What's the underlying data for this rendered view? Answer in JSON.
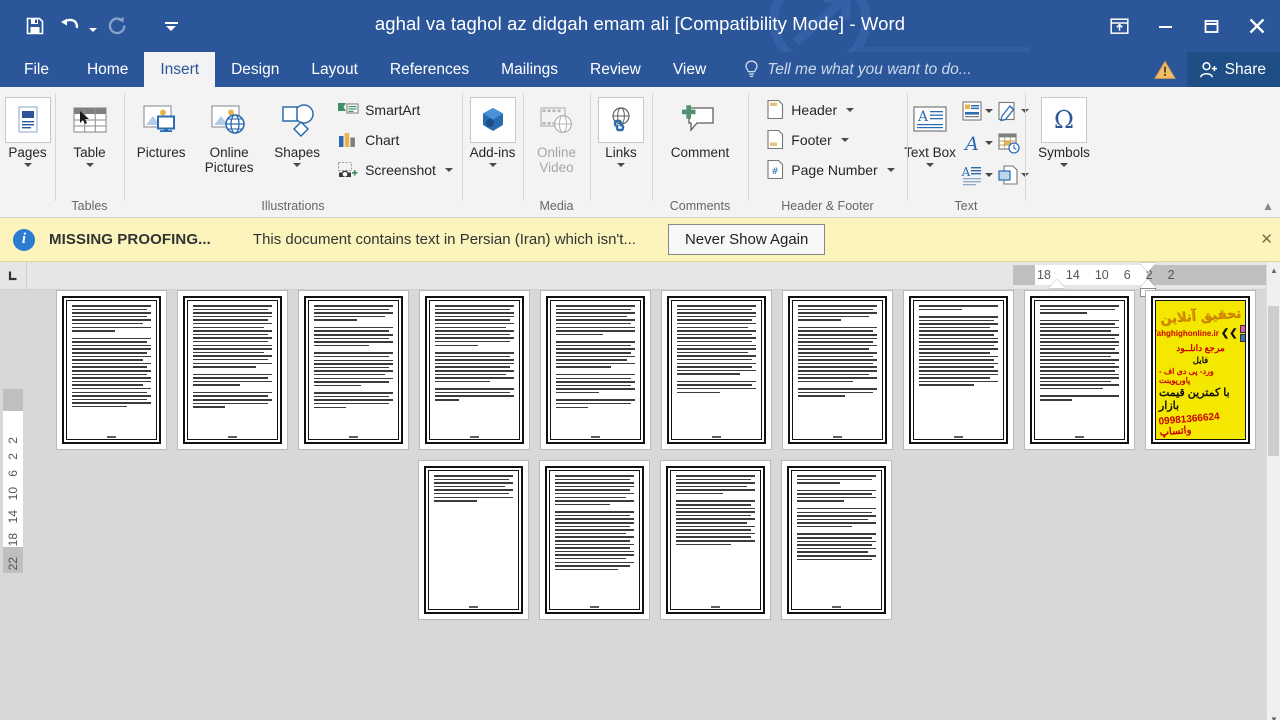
{
  "titlebar": {
    "document_title": "aghal va taghol az didgah emam ali [Compatibility Mode] - Word",
    "quick_access": [
      {
        "name": "save",
        "icon": "save-icon",
        "label": "Save",
        "disabled": false
      },
      {
        "name": "undo",
        "icon": "undo-icon",
        "label": "Undo",
        "disabled": false
      },
      {
        "name": "redo",
        "icon": "redo-icon",
        "label": "Repeat",
        "disabled": true
      },
      {
        "name": "customize",
        "icon": "customize-quick-access-icon",
        "label": "Customize Quick Access Toolbar",
        "disabled": false
      }
    ],
    "window_controls": [
      {
        "name": "ribbon-display-options",
        "icon": "ribbon-display-options-icon",
        "glyph": "⤒"
      },
      {
        "name": "minimize",
        "icon": "minimize-icon",
        "glyph": "–"
      },
      {
        "name": "restore",
        "icon": "restore-icon",
        "glyph": "□"
      },
      {
        "name": "close",
        "icon": "close-icon",
        "glyph": "✕"
      }
    ]
  },
  "tabs": {
    "items": [
      {
        "label": "File",
        "active": false
      },
      {
        "label": "Home",
        "active": false
      },
      {
        "label": "Insert",
        "active": true
      },
      {
        "label": "Design",
        "active": false
      },
      {
        "label": "Layout",
        "active": false
      },
      {
        "label": "References",
        "active": false
      },
      {
        "label": "Mailings",
        "active": false
      },
      {
        "label": "Review",
        "active": false
      },
      {
        "label": "View",
        "active": false
      }
    ],
    "tell_me": "Tell me what you want to do...",
    "share_label": "Share",
    "warning_icon": "warning-triangle-icon"
  },
  "ribbon": {
    "groups": [
      {
        "label": "",
        "name": "pages-group",
        "buttons": [
          {
            "label": "Pages",
            "icon": "pages-icon",
            "has_dropdown": true,
            "disabled": false
          }
        ]
      },
      {
        "label": "Tables",
        "name": "tables-group",
        "buttons": [
          {
            "label": "Table",
            "icon": "table-icon",
            "has_dropdown": true,
            "disabled": false
          }
        ]
      },
      {
        "label": "Illustrations",
        "name": "illustrations-group",
        "buttons": [
          {
            "label": "Pictures",
            "icon": "pictures-icon",
            "has_dropdown": false,
            "disabled": false
          },
          {
            "label": "Online Pictures",
            "icon": "online-pictures-icon",
            "has_dropdown": false,
            "disabled": false
          },
          {
            "label": "Shapes",
            "icon": "shapes-icon",
            "has_dropdown": true,
            "disabled": false
          }
        ],
        "small_buttons": [
          {
            "label": "SmartArt",
            "icon": "smartart-icon",
            "has_dropdown": false
          },
          {
            "label": "Chart",
            "icon": "chart-icon",
            "has_dropdown": false
          },
          {
            "label": "Screenshot",
            "icon": "screenshot-icon",
            "has_dropdown": true
          }
        ]
      },
      {
        "label": "",
        "name": "addins-group",
        "buttons": [
          {
            "label": "Add-ins",
            "icon": "addins-icon",
            "has_dropdown": true,
            "disabled": false
          }
        ]
      },
      {
        "label": "Media",
        "name": "media-group",
        "buttons": [
          {
            "label": "Online Video",
            "icon": "online-video-icon",
            "has_dropdown": false,
            "disabled": true
          }
        ]
      },
      {
        "label": "",
        "name": "links-group",
        "buttons": [
          {
            "label": "Links",
            "icon": "links-icon",
            "has_dropdown": true,
            "disabled": false
          }
        ]
      },
      {
        "label": "Comments",
        "name": "comments-group",
        "buttons": [
          {
            "label": "Comment",
            "icon": "comment-icon",
            "has_dropdown": false,
            "disabled": false
          }
        ]
      },
      {
        "label": "Header & Footer",
        "name": "header-footer-group",
        "small_buttons": [
          {
            "label": "Header",
            "icon": "header-icon",
            "has_dropdown": true
          },
          {
            "label": "Footer",
            "icon": "footer-icon",
            "has_dropdown": true
          },
          {
            "label": "Page Number",
            "icon": "page-number-icon",
            "has_dropdown": true
          }
        ]
      },
      {
        "label": "Text",
        "name": "text-group",
        "buttons": [
          {
            "label": "Text Box",
            "icon": "text-box-icon",
            "has_dropdown": true,
            "disabled": false
          }
        ],
        "icon_grid": [
          {
            "name": "quick-parts-icon",
            "has_dropdown": true
          },
          {
            "name": "signature-line-icon",
            "has_dropdown": true
          },
          {
            "name": "wordart-icon",
            "has_dropdown": true
          },
          {
            "name": "date-and-time-icon",
            "has_dropdown": false
          },
          {
            "name": "drop-cap-icon",
            "has_dropdown": true
          },
          {
            "name": "object-icon",
            "has_dropdown": true
          }
        ]
      },
      {
        "label": "",
        "name": "symbols-group",
        "buttons": [
          {
            "label": "Symbols",
            "icon": "symbols-omega-icon",
            "has_dropdown": true,
            "disabled": false
          }
        ]
      }
    ]
  },
  "info_bar": {
    "icon": "info-icon",
    "title": "MISSING PROOFING...",
    "message": "This document contains text in Persian (Iran) which isn't...",
    "button_label": "Never Show Again",
    "close_glyph": "✕",
    "background_color": "#fbf4bd"
  },
  "rulers": {
    "tab_selector_icon": "left-tab-stop-icon",
    "horizontal_ticks": [
      "18",
      "14",
      "10",
      "6",
      "2",
      "2"
    ],
    "vertical_ticks": [
      "2",
      "2",
      "6",
      "10",
      "14",
      "18",
      "22"
    ]
  },
  "document": {
    "zoom_view": "multiple-pages",
    "page_rows": [
      {
        "pages": [
          {
            "type": "text",
            "name": "page-thumbnail-1"
          },
          {
            "type": "text",
            "name": "page-thumbnail-2"
          },
          {
            "type": "text",
            "name": "page-thumbnail-3"
          },
          {
            "type": "text",
            "name": "page-thumbnail-4"
          },
          {
            "type": "text",
            "name": "page-thumbnail-5"
          },
          {
            "type": "text",
            "name": "page-thumbnail-6"
          },
          {
            "type": "text",
            "name": "page-thumbnail-7"
          },
          {
            "type": "text",
            "name": "page-thumbnail-8"
          },
          {
            "type": "text",
            "name": "page-thumbnail-9"
          },
          {
            "type": "ad",
            "name": "page-thumbnail-10"
          }
        ]
      },
      {
        "pages": [
          {
            "type": "text",
            "name": "page-thumbnail-11"
          },
          {
            "type": "text",
            "name": "page-thumbnail-12"
          },
          {
            "type": "text",
            "name": "page-thumbnail-13"
          },
          {
            "type": "text",
            "name": "page-thumbnail-14"
          }
        ]
      }
    ],
    "ad_page": {
      "heading": "تحقیق آنلاین",
      "website": "Tahghighonline.ir",
      "line_source": "مرجع دانلــود",
      "line_file": "فایل",
      "line_formats": "ورد- پی دی اف - پاورپوینت",
      "line_price": "با کمترین قیمت بازار",
      "line_whatsapp": "09981366624 واتساپ",
      "background_color": "#f5e800",
      "accent_color": "#cc0000"
    }
  },
  "scrollbar": {
    "up_glyph": "▲",
    "down_glyph": "▼"
  }
}
